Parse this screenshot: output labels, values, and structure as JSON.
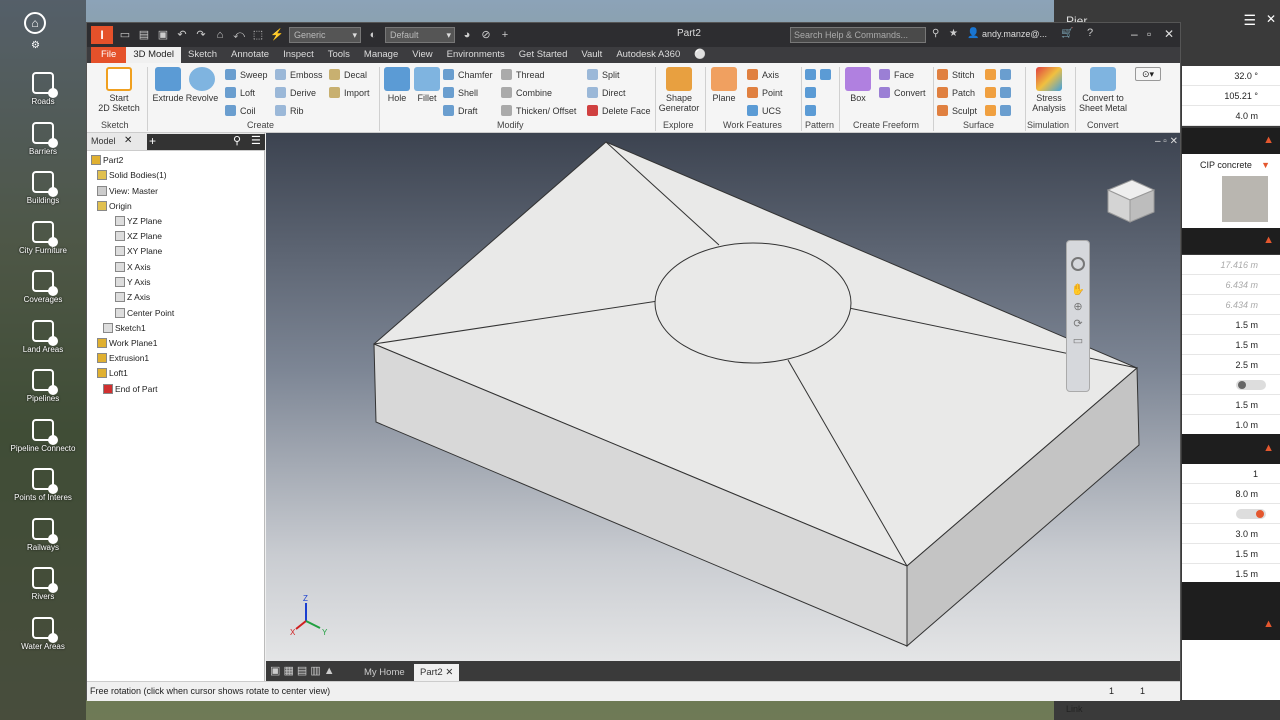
{
  "left_panel": {
    "items": [
      "Roads",
      "Barriers",
      "Buildings",
      "City Furniture",
      "Coverages",
      "Land Areas",
      "Pipelines",
      "Pipeline Connecto",
      "Points of Interes",
      "Railways",
      "Rivers",
      "Water Areas"
    ]
  },
  "right_panel": {
    "title": "Pier",
    "material": "CIP concrete",
    "link_label": "Link",
    "rows_top": [
      "32.0 °",
      "105.21 °",
      "4.0 m"
    ],
    "rows_gray": [
      "17.416 m",
      "6.434 m",
      "6.434 m"
    ],
    "rows_mid": [
      "1.5 m",
      "1.5 m",
      "2.5 m"
    ],
    "rows_mid2": [
      "1.5 m",
      "1.0 m"
    ],
    "rows_bot": [
      "1",
      "8.0 m"
    ],
    "rows_bot2": [
      "3.0 m",
      "1.5 m",
      "1.5 m"
    ]
  },
  "titlebar": {
    "doc_title": "Part2",
    "style_combo": "Generic",
    "appearance_combo": "Default",
    "search_placeholder": "Search Help & Commands...",
    "user": "andy.manze@..."
  },
  "menu_tabs": [
    "File",
    "3D Model",
    "Sketch",
    "Annotate",
    "Inspect",
    "Tools",
    "Manage",
    "View",
    "Environments",
    "Get Started",
    "Vault",
    "Autodesk A360"
  ],
  "active_tab": "3D Model",
  "ribbon": {
    "start_sketch": "Start",
    "start_sketch2": "2D Sketch",
    "extrude": "Extrude",
    "revolve": "Revolve",
    "sweep": "Sweep",
    "loft": "Loft",
    "coil": "Coil",
    "emboss": "Emboss",
    "derive": "Derive",
    "rib": "Rib",
    "decal": "Decal",
    "import": "Import",
    "hole": "Hole",
    "fillet": "Fillet",
    "chamfer": "Chamfer",
    "shell": "Shell",
    "draft": "Draft",
    "thread": "Thread",
    "combine": "Combine",
    "thicken": "Thicken/ Offset",
    "split": "Split",
    "direct": "Direct",
    "delete_face": "Delete Face",
    "shape_gen1": "Shape",
    "shape_gen2": "Generator",
    "plane": "Plane",
    "axis": "Axis",
    "point": "Point",
    "ucs": "UCS",
    "box": "Box",
    "face": "Face",
    "convert": "Convert",
    "stitch": "Stitch",
    "patch": "Patch",
    "sculpt": "Sculpt",
    "stress1": "Stress",
    "stress2": "Analysis",
    "sheet1": "Convert to",
    "sheet2": "Sheet Metal",
    "groups": {
      "sketch": "Sketch",
      "create": "Create",
      "modify": "Modify",
      "explore": "Explore",
      "work_features": "Work Features",
      "pattern": "Pattern",
      "create_freeform": "Create Freeform",
      "surface": "Surface",
      "simulation": "Simulation",
      "convert": "Convert"
    }
  },
  "browser": {
    "tab": "Model",
    "root": "Part2",
    "nodes": [
      "Solid Bodies(1)",
      "View: Master",
      "Origin",
      "YZ Plane",
      "XZ Plane",
      "XY Plane",
      "X Axis",
      "Y Axis",
      "Z Axis",
      "Center Point",
      "Sketch1",
      "Work Plane1",
      "Extrusion1",
      "Loft1",
      "End of Part"
    ]
  },
  "view_tabs": [
    "My Home",
    "Part2"
  ],
  "status": {
    "text": "Free rotation (click when cursor shows rotate to center view)",
    "n1": "1",
    "n2": "1"
  },
  "colors": {
    "file_tab": "#e5512a",
    "accent_orange": "#e4572e",
    "dark_bg": "#2d2d30"
  }
}
